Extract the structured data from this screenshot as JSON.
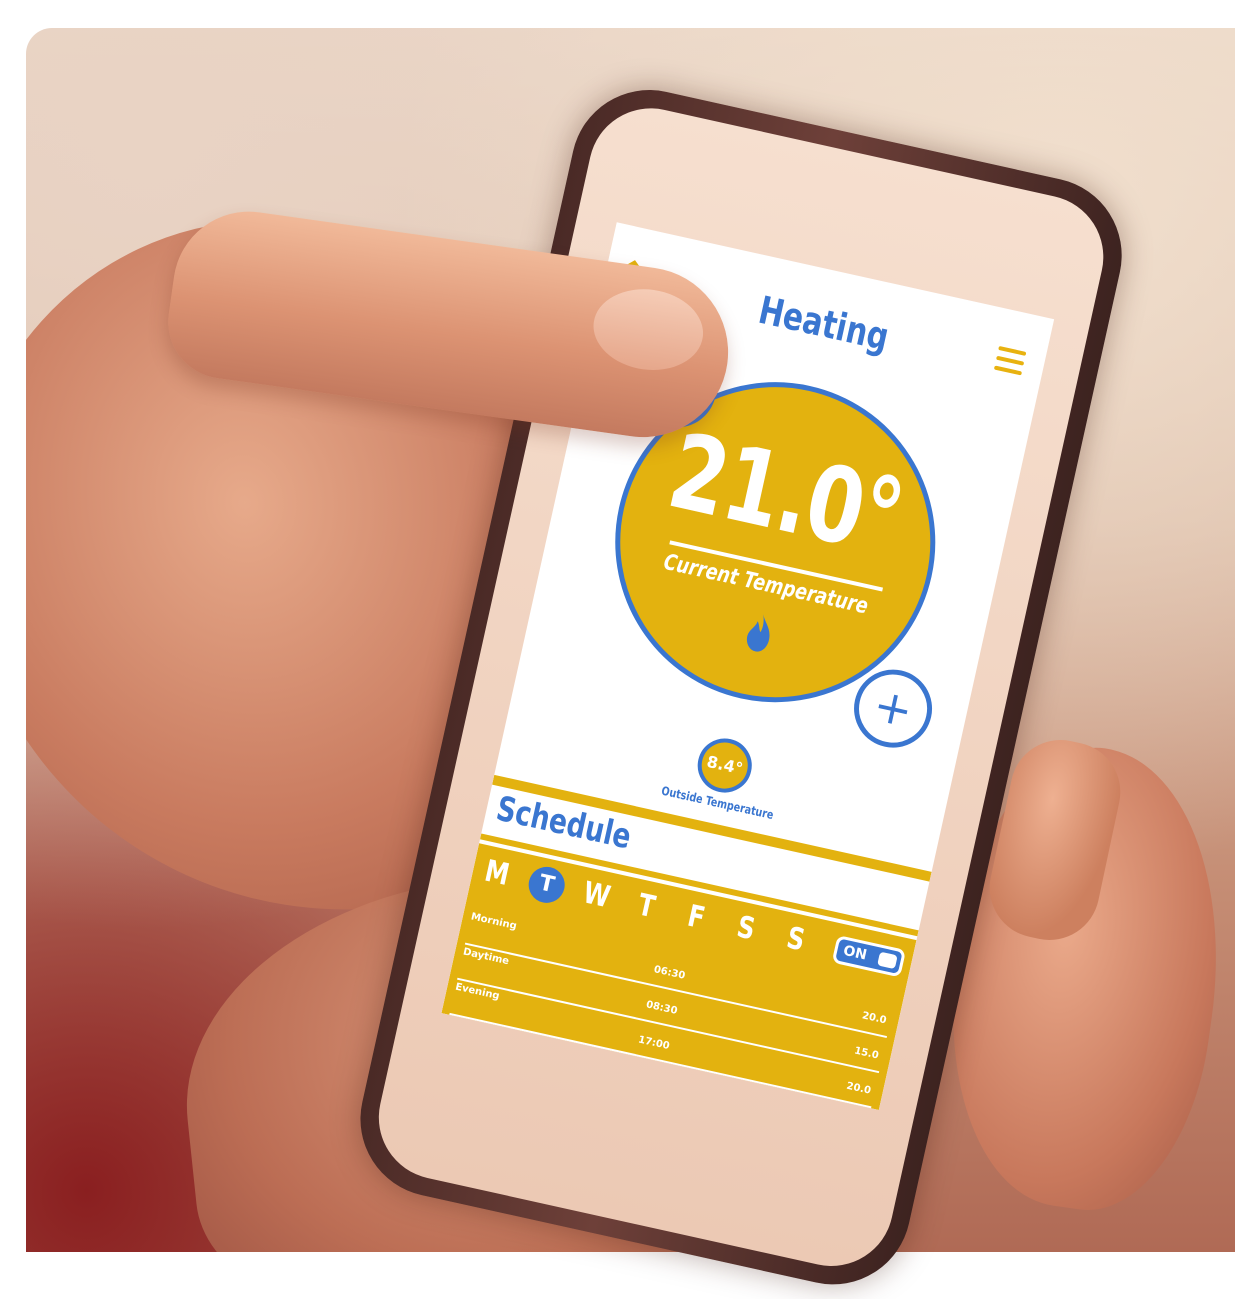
{
  "app": {
    "title": "Heating"
  },
  "thermostat": {
    "current_temp": "21.0°",
    "current_label": "Current Temperature",
    "minus_symbol": "−",
    "plus_symbol": "+"
  },
  "outside": {
    "temp": "8.4°",
    "label": "Outside Temperature"
  },
  "schedule": {
    "title": "Schedule",
    "days": [
      "M",
      "T",
      "W",
      "T",
      "F",
      "S",
      "S"
    ],
    "active_day_index": 1,
    "toggle_label": "ON",
    "toggle_on": true,
    "rows": [
      {
        "label": "Morning",
        "time": "06:30",
        "temp": "20.0"
      },
      {
        "label": "Daytime",
        "time": "08:30",
        "temp": "15.0"
      },
      {
        "label": "Evening",
        "time": "17:00",
        "temp": "20.0"
      }
    ]
  },
  "colors": {
    "accent_yellow": "#e3b20f",
    "accent_blue": "#3a76d0"
  },
  "icons": {
    "home": "home-icon",
    "menu": "hamburger-menu-icon",
    "flame": "flame-icon"
  }
}
